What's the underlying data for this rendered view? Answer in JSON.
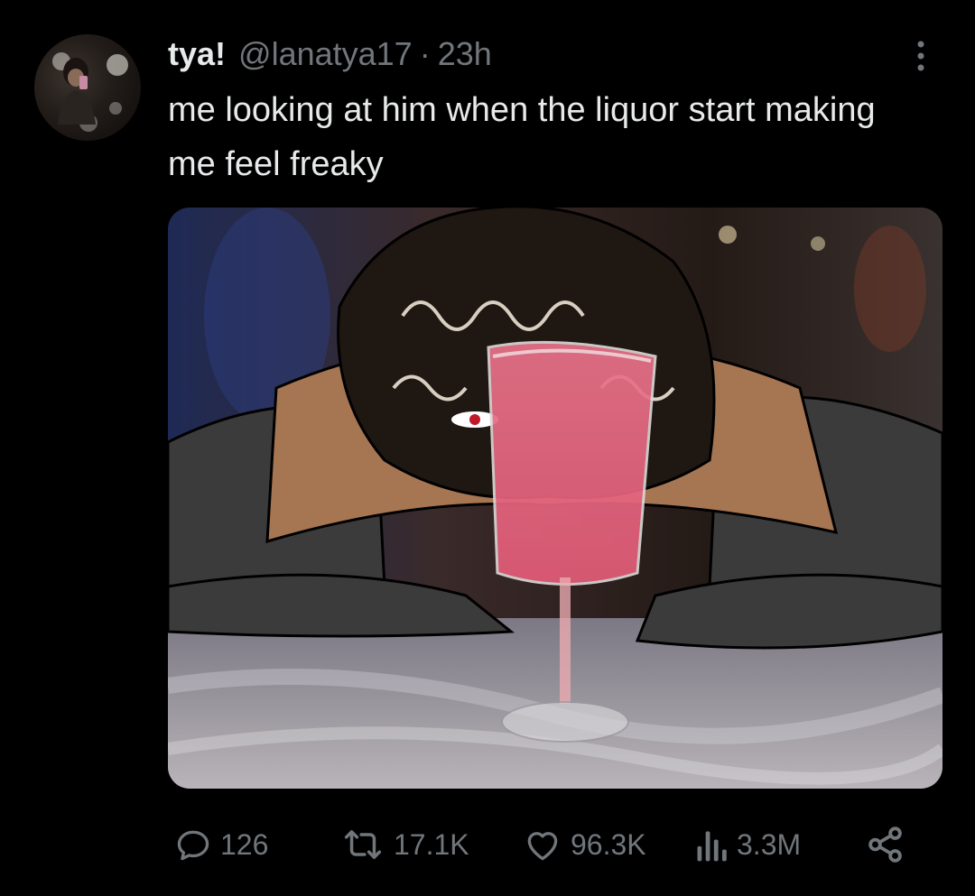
{
  "tweet": {
    "author": {
      "display_name": "tya!",
      "handle": "@lanatya17",
      "separator": "·",
      "timestamp": "23h"
    },
    "text": "me looking at him when the liquor start making me feel freaky",
    "media": {
      "type": "image"
    },
    "actions": {
      "replies": "126",
      "reposts": "17.1K",
      "likes": "96.3K",
      "views": "3.3M"
    }
  },
  "colors": {
    "background": "#000000",
    "primary_text": "#e7e9ea",
    "secondary_text": "#71767b"
  },
  "icons": [
    "reply-icon",
    "repost-icon",
    "like-icon",
    "views-icon",
    "share-icon",
    "more-icon"
  ]
}
